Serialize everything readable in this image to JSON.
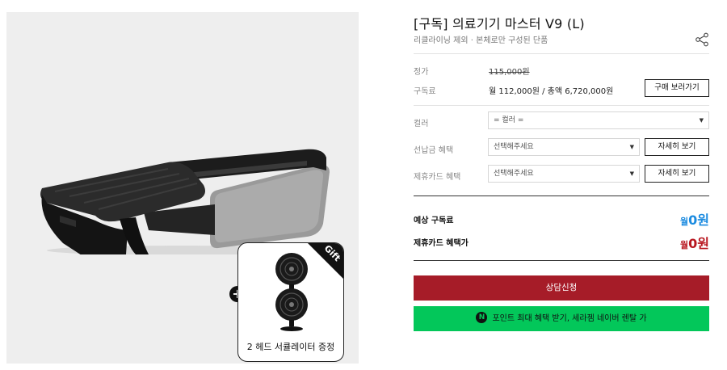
{
  "product": {
    "title": "[구독] 의료기기 마스터 V9 (L)",
    "subtitle": "리클라이닝 제외 · 본체로만 구성된 단품"
  },
  "gift": {
    "ribbon": "Gift",
    "caption": "2 헤드 서큘레이터 증정",
    "plus": "+"
  },
  "pricing": {
    "regular_label": "정가",
    "regular_value": "115,000원",
    "subscription_label": "구독료",
    "subscription_value": "월 112,000원 / 총액 6,720,000원",
    "buy_button": "구매 보러가기"
  },
  "options": {
    "color_label": "컬러",
    "color_value": "= 컬러 =",
    "prepay_label": "선납금 혜택",
    "prepay_value": "선택해주세요",
    "prepay_button": "자세히 보기",
    "card_label": "제휴카드 혜택",
    "card_value": "선택해주세요",
    "card_button": "자세히 보기",
    "caret": "▼"
  },
  "summary": {
    "expected_label": "예상 구독료",
    "expected_unit": "월",
    "expected_value": "0원",
    "card_price_label": "제휴카드 혜택가",
    "card_price_unit": "월",
    "card_price_value": "0원"
  },
  "actions": {
    "consult_button": "상담신청",
    "naver_logo": "N",
    "naver_button": "포인트 최대 혜택 받기, 세라젬 네이버 렌탈 가"
  },
  "colors": {
    "accent_red": "#a61c28",
    "naver_green": "#03c75a",
    "price_blue": "#1b8be0",
    "price_red": "#b8161f"
  }
}
